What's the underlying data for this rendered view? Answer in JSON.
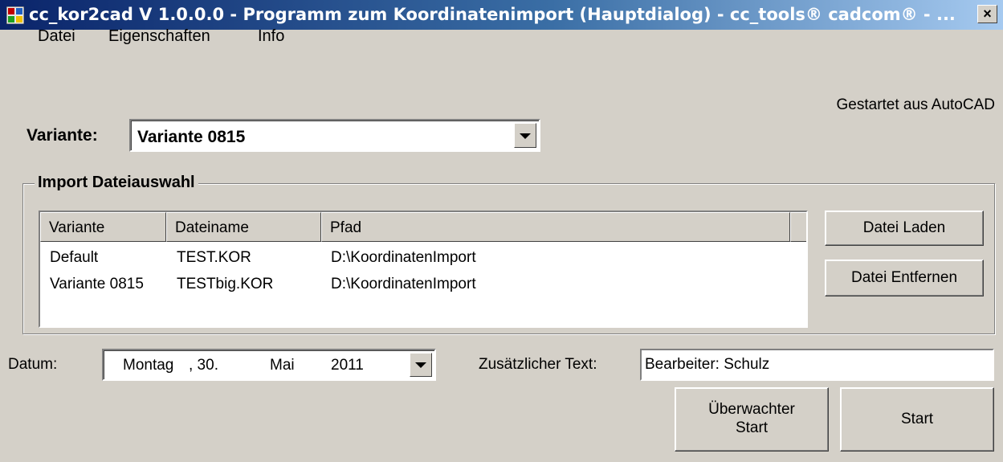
{
  "window": {
    "title": "cc_kor2cad V 1.0.0.0 - Programm zum Koordinatenimport (Hauptdialog) - cc_tools® cadcom® - ...",
    "icon": "app-icon",
    "close_label": "×"
  },
  "menu": {
    "items": [
      {
        "label": "Datei"
      },
      {
        "label": "Eigenschaften"
      },
      {
        "label": "Info"
      }
    ]
  },
  "status": "Gestartet aus AutoCAD",
  "variante": {
    "label": "Variante:",
    "value": "Variante 0815"
  },
  "import_group": {
    "title": "Import Dateiauswahl",
    "columns": [
      "Variante",
      "Dateiname",
      "Pfad"
    ],
    "rows": [
      [
        "Default",
        "TEST.KOR",
        "D:\\KoordinatenImport"
      ],
      [
        "Variante 0815",
        "TESTbig.KOR",
        "D:\\KoordinatenImport"
      ]
    ],
    "btn_laden": "Datei Laden",
    "btn_entfernen": "Datei Entfernen"
  },
  "datum": {
    "label": "Datum:",
    "weekday": "Montag",
    "day": ", 30.",
    "month": "Mai",
    "year": "2011"
  },
  "zusatz": {
    "label": "Zusätzlicher Text:",
    "value": "Bearbeiter: Schulz"
  },
  "buttons": {
    "ueberwachter_start": "Überwachter Start",
    "start": "Start"
  },
  "colors": {
    "title_start": "#0a246a",
    "title_end": "#a6caf0",
    "face": "#d4d0c8"
  }
}
